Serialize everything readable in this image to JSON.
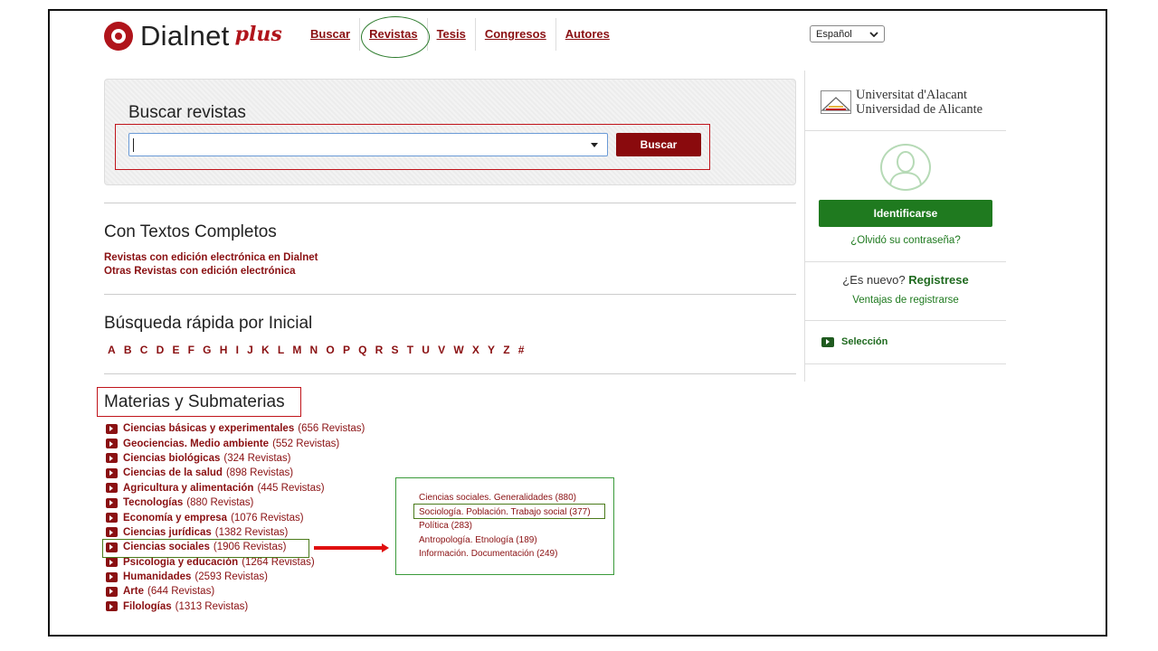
{
  "header": {
    "logo_text": "Dialnet",
    "logo_plus": "plus",
    "nav": [
      "Buscar",
      "Revistas",
      "Tesis",
      "Congresos",
      "Autores"
    ],
    "language": "Español"
  },
  "search": {
    "title": "Buscar revistas",
    "button": "Buscar"
  },
  "textos": {
    "title": "Con Textos Completos",
    "links": [
      "Revistas con edición electrónica en Dialnet",
      "Otras Revistas con edición electrónica"
    ]
  },
  "inicial": {
    "title": "Búsqueda rápida por Inicial",
    "letters": [
      "A",
      "B",
      "C",
      "D",
      "E",
      "F",
      "G",
      "H",
      "I",
      "J",
      "K",
      "L",
      "M",
      "N",
      "O",
      "P",
      "Q",
      "R",
      "S",
      "T",
      "U",
      "V",
      "W",
      "X",
      "Y",
      "Z",
      "#"
    ]
  },
  "materias": {
    "title": "Materias y Submaterias",
    "items": [
      {
        "name": "Ciencias básicas y experimentales",
        "count": "(656 Revistas)"
      },
      {
        "name": "Geociencias. Medio ambiente",
        "count": "(552 Revistas)"
      },
      {
        "name": "Ciencias biológicas",
        "count": "(324 Revistas)"
      },
      {
        "name": "Ciencias de la salud",
        "count": "(898 Revistas)"
      },
      {
        "name": "Agricultura y alimentación",
        "count": "(445 Revistas)"
      },
      {
        "name": "Tecnologías",
        "count": "(880 Revistas)"
      },
      {
        "name": "Economía y empresa",
        "count": "(1076 Revistas)"
      },
      {
        "name": "Ciencias jurídicas",
        "count": "(1382 Revistas)"
      },
      {
        "name": "Ciencias sociales",
        "count": "(1906 Revistas)"
      },
      {
        "name": "Psicología y educación",
        "count": "(1264 Revistas)"
      },
      {
        "name": "Humanidades",
        "count": "(2593 Revistas)"
      },
      {
        "name": "Arte",
        "count": "(644 Revistas)"
      },
      {
        "name": "Filologías",
        "count": "(1313 Revistas)"
      }
    ],
    "submaterias": [
      "Ciencias sociales. Generalidades (880)",
      "Sociología. Población. Trabajo social (377)",
      "Política (283)",
      "Antropología. Etnología (189)",
      "Información. Documentación (249)"
    ]
  },
  "sidebar": {
    "uni_line1": "Universitat d'Alacant",
    "uni_line2": "Universidad de Alicante",
    "login_button": "Identificarse",
    "forgot": "¿Olvidó su contraseña?",
    "new_user": "¿Es nuevo?",
    "register": "Registrese",
    "ventajas": "Ventajas de registrarse",
    "seleccion": "Selección"
  }
}
